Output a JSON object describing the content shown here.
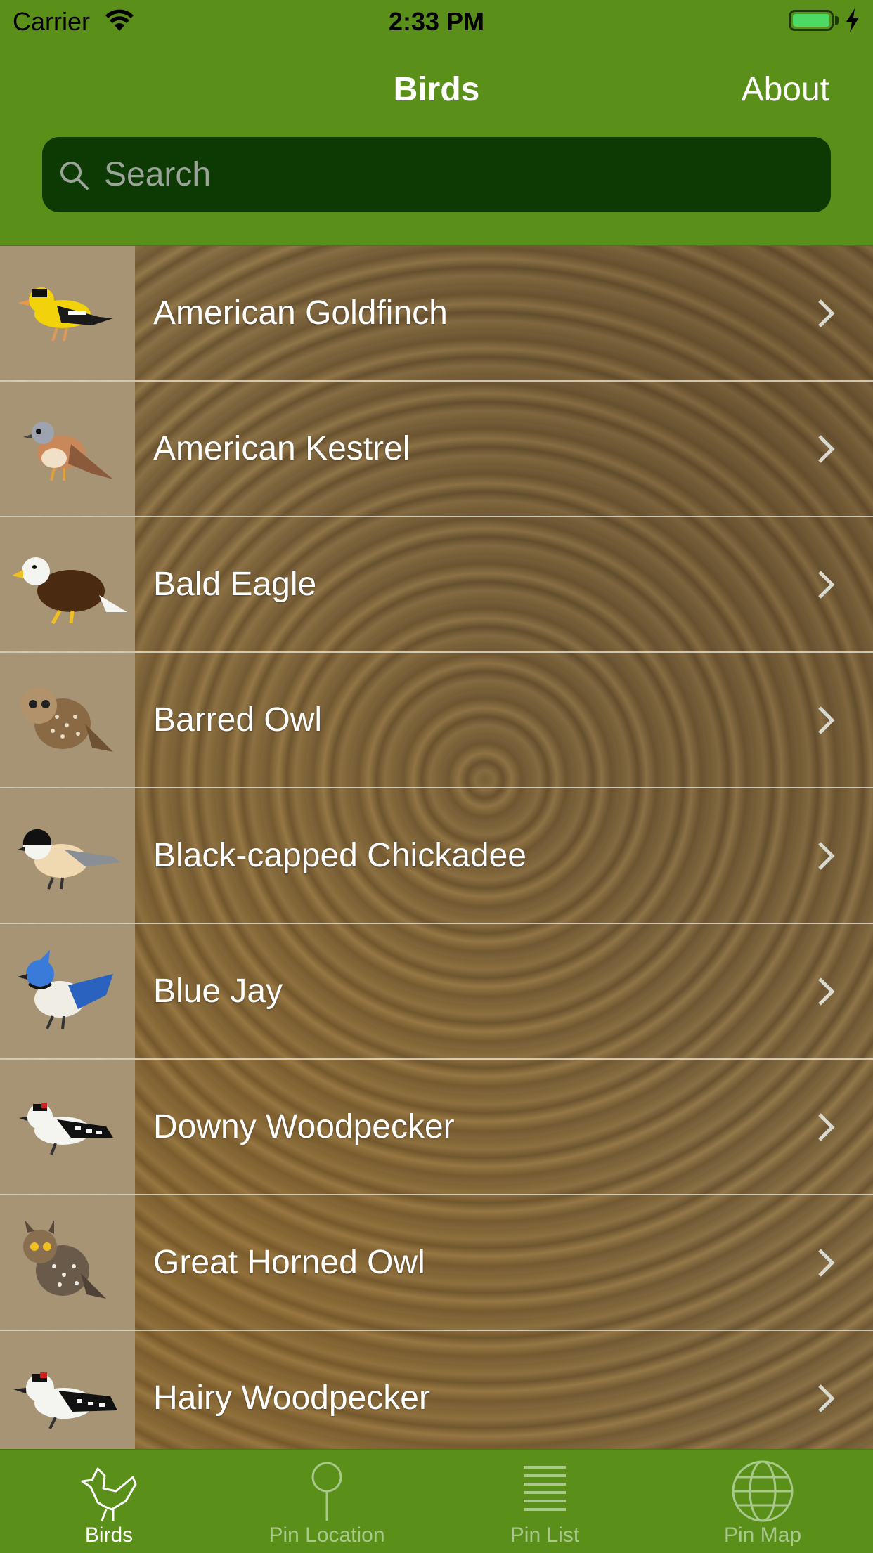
{
  "status_bar": {
    "carrier": "Carrier",
    "time": "2:33 PM"
  },
  "nav": {
    "title": "Birds",
    "right_button": "About"
  },
  "search": {
    "placeholder": "Search",
    "value": ""
  },
  "birds": [
    {
      "name": "American Goldfinch",
      "icon": "goldfinch-icon"
    },
    {
      "name": "American Kestrel",
      "icon": "kestrel-icon"
    },
    {
      "name": "Bald Eagle",
      "icon": "eagle-icon"
    },
    {
      "name": "Barred Owl",
      "icon": "barred-owl-icon"
    },
    {
      "name": "Black-capped Chickadee",
      "icon": "chickadee-icon"
    },
    {
      "name": "Blue Jay",
      "icon": "blue-jay-icon"
    },
    {
      "name": "Downy Woodpecker",
      "icon": "downy-woodpecker-icon"
    },
    {
      "name": "Great Horned Owl",
      "icon": "great-horned-owl-icon"
    },
    {
      "name": "Hairy Woodpecker",
      "icon": "hairy-woodpecker-icon"
    }
  ],
  "tabs": [
    {
      "label": "Birds",
      "icon": "bird-icon",
      "active": true
    },
    {
      "label": "Pin Location",
      "icon": "pin-icon",
      "active": false
    },
    {
      "label": "Pin List",
      "icon": "list-icon",
      "active": false
    },
    {
      "label": "Pin Map",
      "icon": "globe-icon",
      "active": false
    }
  ],
  "colors": {
    "bar_green": "#5a8f1a",
    "search_bg": "#0d3a02",
    "battery": "#4cd964",
    "active_tab": "#ffffff",
    "inactive_tab": "#a9c98a"
  }
}
